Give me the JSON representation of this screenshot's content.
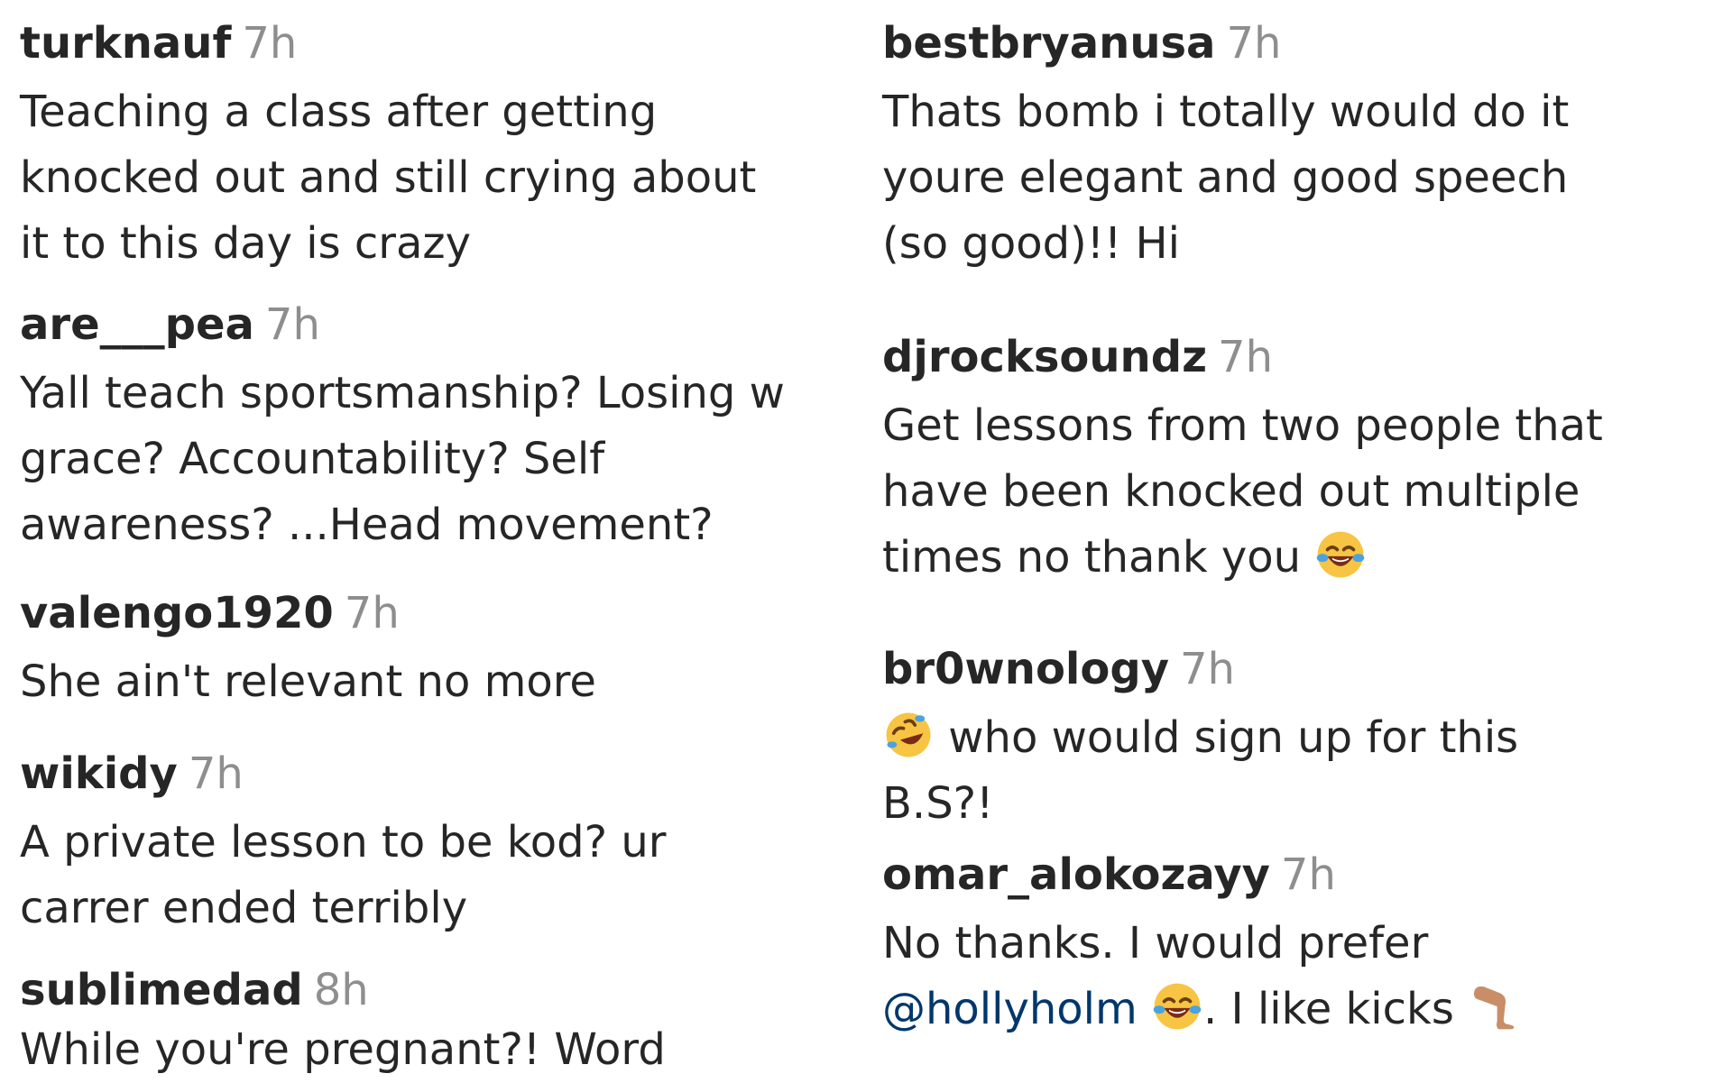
{
  "left_column": [
    {
      "username": "turknauf",
      "time": "7h",
      "lines": [
        "Teaching a class after getting",
        "knocked out and still crying about",
        "it to this day is crazy"
      ]
    },
    {
      "username": "are___pea",
      "time": "7h",
      "lines": [
        "Yall teach sportsmanship? Losing w",
        "grace? Accountability? Self",
        "awareness? ...Head movement?"
      ]
    },
    {
      "username": "valengo1920",
      "time": "7h",
      "lines": [
        "She ain't relevant no more"
      ]
    },
    {
      "username": "wikidy",
      "time": "7h",
      "lines": [
        "A private lesson to be kod? ur",
        "carrer ended terribly"
      ]
    },
    {
      "username": "sublimedad",
      "time": "8h",
      "lines": [
        "While you're pregnant?! Word"
      ]
    }
  ],
  "right_column": [
    {
      "username": "bestbryanusa",
      "time": "7h",
      "lines": [
        "Thats bomb i totally would do it",
        "youre elegant and good speech",
        "(so good)!! Hi"
      ]
    },
    {
      "username": "djrocksoundz",
      "time": "7h",
      "lines": [
        "Get lessons from two people that",
        "have been knocked out multiple"
      ],
      "last_line_text": "times no thank you",
      "last_line_emoji": "laughing-tears-emoji"
    },
    {
      "username": "br0wnology",
      "time": "7h",
      "lead_emoji": "rolling-laughing-emoji",
      "first_line_text": "who would sign up for this",
      "second_line": "B.S?!"
    },
    {
      "username": "omar_alokozayy",
      "time": "7h",
      "first_line": "No thanks. I would prefer",
      "mention": "@hollyholm",
      "after_mention": ". I like kicks",
      "emoji_1": "laughing-tears-emoji",
      "emoji_2": "leg-emoji"
    }
  ],
  "colors": {
    "text": "#262626",
    "timestamp": "#8e8e8e",
    "mention": "#00376b"
  }
}
